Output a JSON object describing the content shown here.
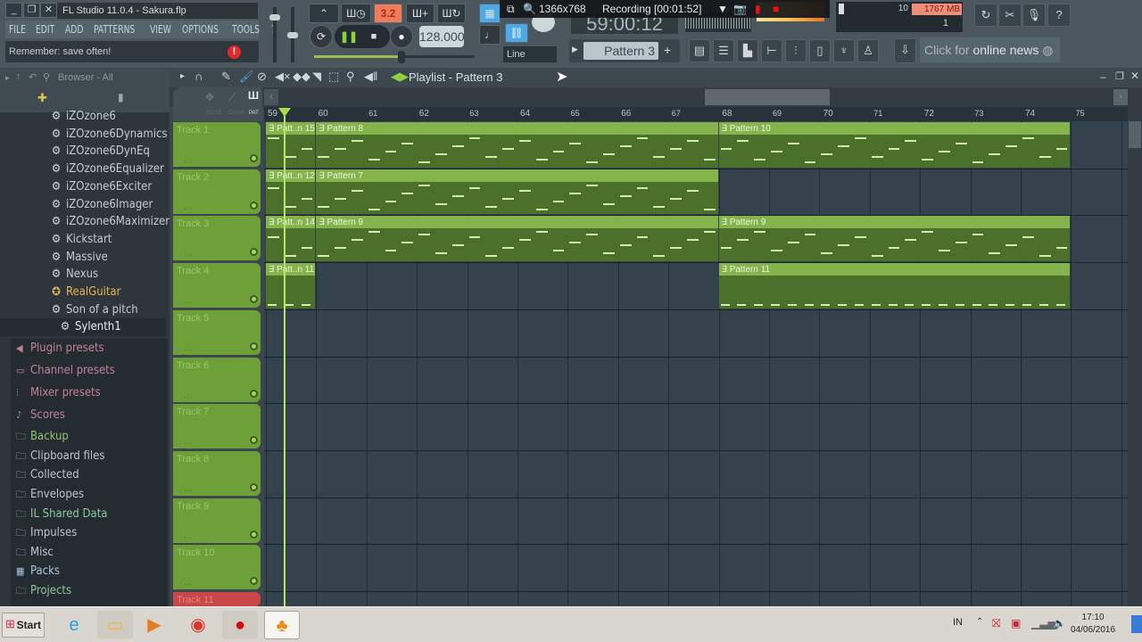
{
  "window": {
    "title": "FL Studio 11.0.4 - Sakura.flp",
    "minimize": "_",
    "restore": "❐",
    "close": "✕"
  },
  "menu": [
    "FILE",
    "EDIT",
    "ADD",
    "PATTERNS",
    "VIEW",
    "OPTIONS",
    "TOOLS",
    "?"
  ],
  "hint": {
    "text": "Remember: save often!",
    "warning_icon": "!"
  },
  "transport": {
    "song_mode_label": "3.2",
    "bpm": "128.000",
    "snap_label": "Line",
    "time_display": "59:00:12",
    "pattern": "Pattern 3",
    "pattern_add": "+",
    "tempo_fraction": 0.55
  },
  "recording_overlay": {
    "resolution": "1366x768",
    "status": "Recording [00:01:52]"
  },
  "cpu": {
    "polyphony": "10",
    "memory": "1767 MB",
    "voices": "1"
  },
  "news": {
    "prefix": "Click for",
    "suffix": "online news"
  },
  "browser": {
    "title": "Browser - All",
    "plugins": [
      {
        "label": "iZOzone6",
        "highlight": false
      },
      {
        "label": "iZOzone6Dynamics",
        "highlight": false
      },
      {
        "label": "iZOzone6DynEq",
        "highlight": false
      },
      {
        "label": "iZOzone6Equalizer",
        "highlight": false
      },
      {
        "label": "iZOzone6Exciter",
        "highlight": false
      },
      {
        "label": "iZOzone6Imager",
        "highlight": false
      },
      {
        "label": "iZOzone6Maximizer",
        "highlight": false
      },
      {
        "label": "Kickstart",
        "highlight": false
      },
      {
        "label": "Massive",
        "highlight": false
      },
      {
        "label": "Nexus",
        "highlight": false
      },
      {
        "label": "RealGuitar",
        "highlight": true
      },
      {
        "label": "Son of a pitch",
        "highlight": false
      },
      {
        "label": "Sylenth1",
        "highlight": false,
        "selected": true
      }
    ],
    "folders": [
      {
        "label": "Plugin presets",
        "color": "#c3809a",
        "icon": "◀"
      },
      {
        "label": "Channel presets",
        "color": "#c3809a",
        "icon": "▭"
      },
      {
        "label": "Mixer presets",
        "color": "#c3809a",
        "icon": "⫶"
      },
      {
        "label": "Scores",
        "color": "#c3809a",
        "icon": "♪"
      },
      {
        "label": "Backup",
        "color": "#8fc472",
        "icon": "🗀"
      },
      {
        "label": "Clipboard files",
        "color": "#b8c6cd",
        "icon": "🗀"
      },
      {
        "label": "Collected",
        "color": "#b8c6cd",
        "icon": "🗀"
      },
      {
        "label": "Envelopes",
        "color": "#b8c6cd",
        "icon": "🗀"
      },
      {
        "label": "IL Shared Data",
        "color": "#8fc4a0",
        "icon": "🗀"
      },
      {
        "label": "Impulses",
        "color": "#b8c6cd",
        "icon": "🗀"
      },
      {
        "label": "Misc",
        "color": "#b8c6cd",
        "icon": "🗀"
      },
      {
        "label": "Packs",
        "color": "#a9c4dc",
        "icon": "▦"
      },
      {
        "label": "Projects",
        "color": "#8fc4a0",
        "icon": "🗀"
      }
    ]
  },
  "playlist": {
    "title": "Playlist - Pattern 3",
    "mode_labels": [
      "NOTE",
      "CHAN",
      "PAT"
    ],
    "bars": [
      "59",
      "60",
      "61",
      "62",
      "63",
      "64",
      "65",
      "66",
      "67",
      "68",
      "69",
      "70",
      "71",
      "72",
      "73",
      "74",
      "75"
    ],
    "tracks": [
      {
        "name": "Track 1",
        "clips": [
          {
            "label": "Patt..n 15",
            "start": 0,
            "len": 1
          },
          {
            "label": "Pattern 8",
            "start": 1,
            "len": 8
          },
          {
            "label": "Pattern 10",
            "start": 9,
            "len": 7
          }
        ]
      },
      {
        "name": "Track 2",
        "clips": [
          {
            "label": "Patt..n 12",
            "start": 0,
            "len": 1
          },
          {
            "label": "Pattern 7",
            "start": 1,
            "len": 8
          }
        ]
      },
      {
        "name": "Track 3",
        "clips": [
          {
            "label": "Patt..n 14",
            "start": 0,
            "len": 1
          },
          {
            "label": "Pattern 9",
            "start": 1,
            "len": 8
          },
          {
            "label": "Pattern 9",
            "start": 9,
            "len": 7
          }
        ]
      },
      {
        "name": "Track 4",
        "clips": [
          {
            "label": "Patt..n 11",
            "start": 0,
            "len": 1
          },
          {
            "label": "Pattern 11",
            "start": 9,
            "len": 7
          }
        ]
      },
      {
        "name": "Track 5",
        "clips": []
      },
      {
        "name": "Track 6",
        "clips": []
      },
      {
        "name": "Track 7",
        "clips": []
      },
      {
        "name": "Track 8",
        "clips": []
      },
      {
        "name": "Track 9",
        "clips": []
      },
      {
        "name": "Track 10",
        "clips": []
      },
      {
        "name": "Track 11",
        "clips": []
      }
    ]
  },
  "taskbar": {
    "start": "Start",
    "lang": "IN",
    "time": "17:10",
    "date": "04/06/2016"
  }
}
